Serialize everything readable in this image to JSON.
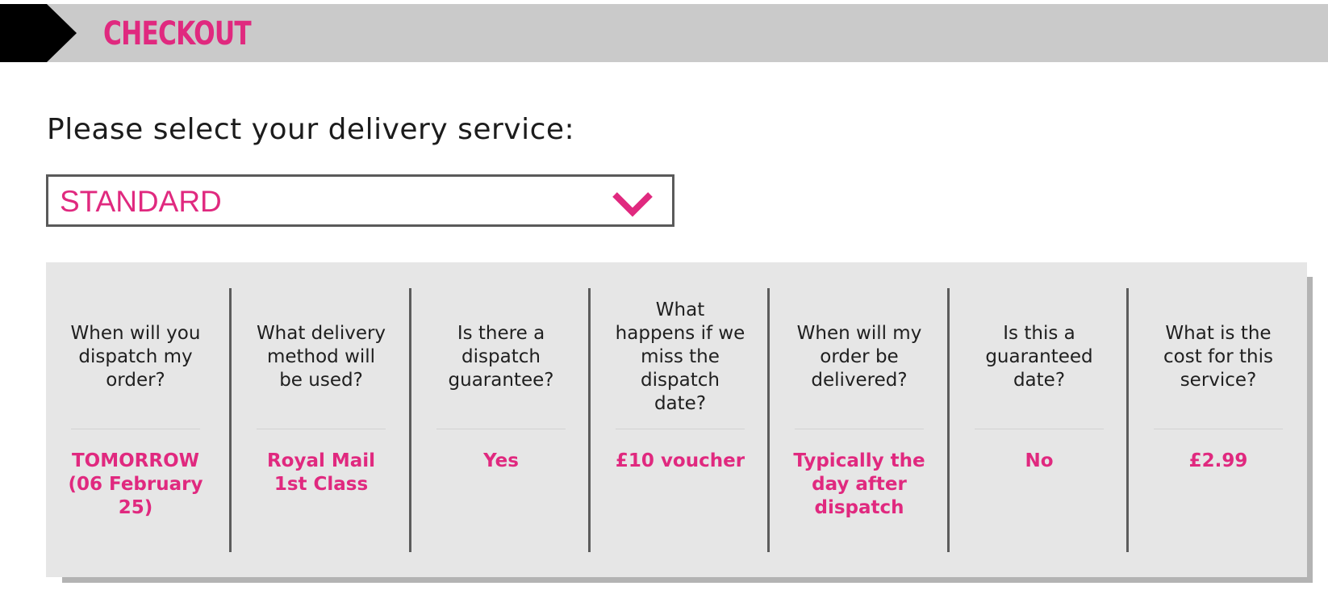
{
  "header": {
    "title": "CHECKOUT"
  },
  "delivery": {
    "prompt": "Please select your delivery service:",
    "selected": "STANDARD"
  },
  "info": {
    "columns": [
      {
        "question": "When will you dispatch my order?",
        "answer": "TOMORROW (06 February 25)"
      },
      {
        "question": "What delivery method will be used?",
        "answer": "Royal Mail 1st Class"
      },
      {
        "question": "Is there a dispatch guarantee?",
        "answer": "Yes"
      },
      {
        "question": "What happens if we miss the dispatch date?",
        "answer": "£10 voucher"
      },
      {
        "question": "When will my order be delivered?",
        "answer": "Typically the day after dispatch"
      },
      {
        "question": "Is this a guaranteed date?",
        "answer": "No"
      },
      {
        "question": "What is the cost for this service?",
        "answer": "£2.99"
      }
    ]
  },
  "colors": {
    "accent": "#e0297f",
    "header_bg": "#cacaca",
    "panel_bg": "#e6e6e6"
  },
  "icons": {
    "dropdown": "chevron-down-icon"
  }
}
